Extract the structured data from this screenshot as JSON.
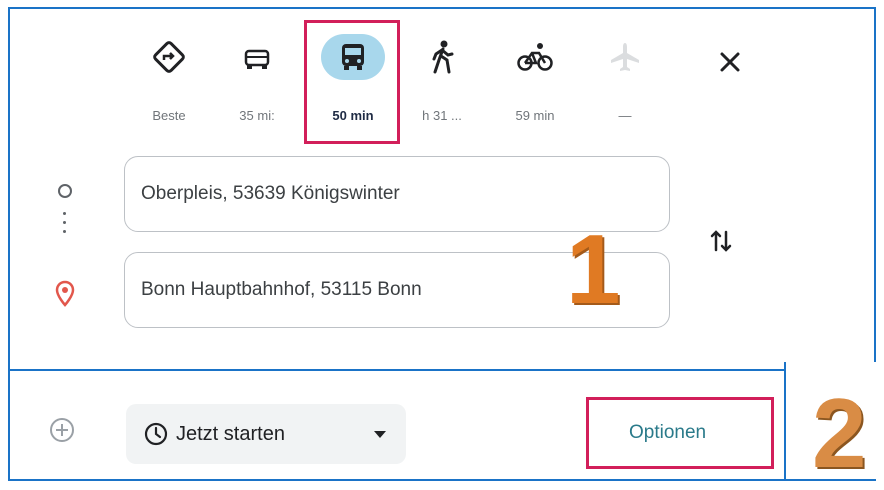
{
  "travel_modes": [
    {
      "name": "best",
      "icon": "route-diamond-icon",
      "label": "Beste"
    },
    {
      "name": "car",
      "icon": "car-icon",
      "label": "35 mi:"
    },
    {
      "name": "transit",
      "icon": "bus-icon",
      "label": "50 min",
      "active": true
    },
    {
      "name": "walk",
      "icon": "walking-icon",
      "label": "h 31 ..."
    },
    {
      "name": "bike",
      "icon": "bicycle-icon",
      "label": "59 min"
    },
    {
      "name": "flight",
      "icon": "airplane-icon",
      "label": "—",
      "disabled": true
    }
  ],
  "origin": {
    "value": "Oberpleis, 53639 Königswinter"
  },
  "destination": {
    "value": "Bonn Hauptbahnhof, 53115 Bonn"
  },
  "annotations": {
    "one": "1",
    "two": "2"
  },
  "departure": {
    "label": "Jetzt starten"
  },
  "options": {
    "label": "Optionen"
  },
  "colors": {
    "accent_bubble": "#a8d7ec",
    "highlight_border": "#d21f5a",
    "frame_border": "#1a73c7",
    "options_text": "#2a7a8a",
    "badge_orange": "#e07a23"
  }
}
